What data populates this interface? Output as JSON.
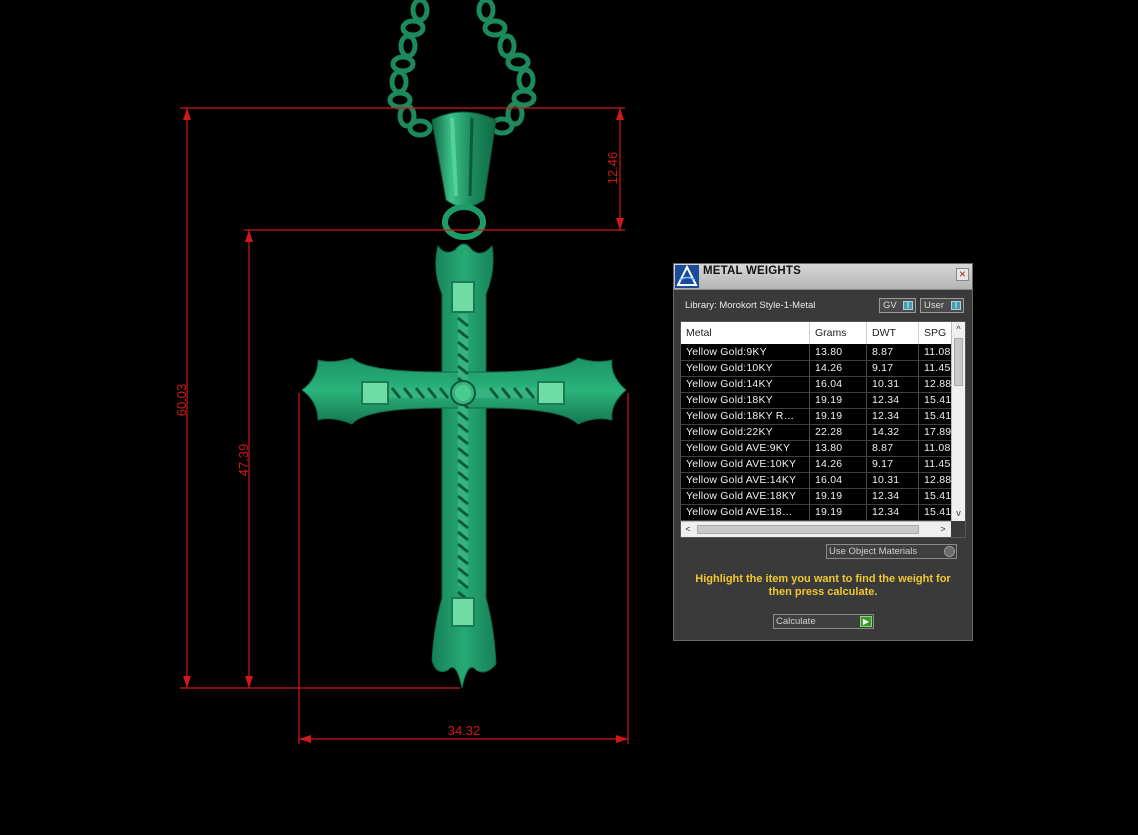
{
  "viewport": {
    "dimensions": {
      "height": "60.03",
      "body_height": "47.39",
      "bail_height": "12.46",
      "width": "34.32"
    },
    "colors": {
      "dimension_line": "#d01818",
      "model": "#1f9a6a",
      "background": "#000000"
    }
  },
  "panel": {
    "title": "METAL WEIGHTS",
    "close_icon": "×",
    "library_label": "Library: Morokort Style-1-Metal",
    "gv_toggle": {
      "label": "GV",
      "state": "I"
    },
    "user_toggle": {
      "label": "User",
      "state": "I"
    },
    "table": {
      "columns": [
        "Metal",
        "Grams",
        "DWT",
        "SPG"
      ],
      "rows": [
        [
          "Yellow Gold:9KY",
          "13.80",
          "8.87",
          "11.08"
        ],
        [
          "Yellow Gold:10KY",
          "14.26",
          "9.17",
          "11.45"
        ],
        [
          "Yellow Gold:14KY",
          "16.04",
          "10.31",
          "12.88"
        ],
        [
          "Yellow Gold:18KY",
          "19.19",
          "12.34",
          "15.41"
        ],
        [
          "Yellow Gold:18KY R…",
          "19.19",
          "12.34",
          "15.41"
        ],
        [
          "Yellow Gold:22KY",
          "22.28",
          "14.32",
          "17.89"
        ],
        [
          "Yellow Gold AVE:9KY",
          "13.80",
          "8.87",
          "11.08"
        ],
        [
          "Yellow Gold AVE:10KY",
          "14.26",
          "9.17",
          "11.45"
        ],
        [
          "Yellow Gold AVE:14KY",
          "16.04",
          "10.31",
          "12.88"
        ],
        [
          "Yellow Gold AVE:18KY",
          "19.19",
          "12.34",
          "15.41"
        ],
        [
          "Yellow Gold AVE:18…",
          "19.19",
          "12.34",
          "15.41"
        ]
      ],
      "scroll_up_icon": "^",
      "scroll_down_icon": "v",
      "scroll_left_icon": "<",
      "scroll_right_icon": ">"
    },
    "materials_combo": "Use Object Materials",
    "instructions": "Highlight the item you want to find the weight for then press calculate.",
    "calculate_label": "Calculate",
    "calculate_icon": "▶",
    "colors": {
      "panel_bg": "#3a3a3a",
      "instruction_text": "#f0c830",
      "toggle_knob": "#4a9ab0",
      "calc_go": "#3a9a2a"
    }
  }
}
